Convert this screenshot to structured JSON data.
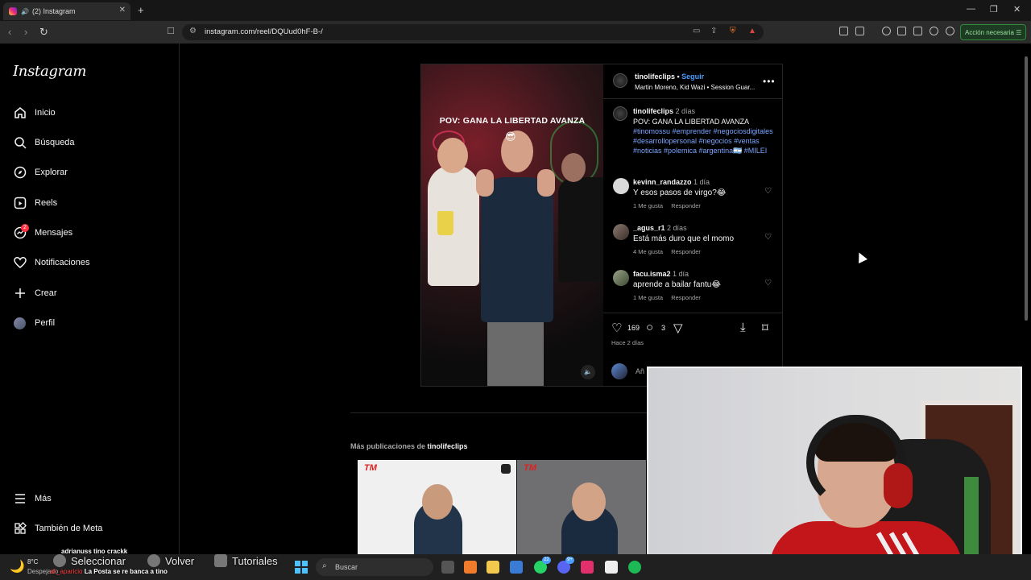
{
  "browser": {
    "tab_title": "(2) Instagram",
    "new_tab_label": "+",
    "url": "instagram.com/reel/DQUud0hF-B-/",
    "action_button": "Acción necesaria"
  },
  "sidebar": {
    "logo": "Instagram",
    "items": [
      {
        "label": "Inicio",
        "icon": "home-icon"
      },
      {
        "label": "Búsqueda",
        "icon": "search-icon"
      },
      {
        "label": "Explorar",
        "icon": "compass-icon"
      },
      {
        "label": "Reels",
        "icon": "reels-icon"
      },
      {
        "label": "Mensajes",
        "icon": "messenger-icon",
        "badge": "2"
      },
      {
        "label": "Notificaciones",
        "icon": "heart-icon"
      },
      {
        "label": "Crear",
        "icon": "plus-icon"
      },
      {
        "label": "Perfil",
        "icon": "avatar-icon"
      }
    ],
    "more": "Más",
    "meta": "También de Meta"
  },
  "post": {
    "video_caption": "POV: GANA LA LIBERTAD AVANZA",
    "video_emoji": "😎",
    "header_user": "tinolifeclips",
    "follow_separator": " • ",
    "follow_label": "Seguir",
    "header_sub": "Martin Moreno, Kid Wazi • Session Guar...",
    "caption_user": "tinolifeclips",
    "caption_time": "2 días",
    "caption_text": "POV: GANA LA LIBERTAD AVANZA",
    "hashtags": "#tinomossu #emprender #negociosdigitales #desarrollopersonal #negocios #ventas #noticias #polemica #argentina🇦🇷 #MILEI",
    "comments": [
      {
        "user": "kevinn_randazzo",
        "time": "1 día",
        "text": "Y esos pasos de virgo?😂",
        "likes": "1 Me gusta",
        "reply": "Responder"
      },
      {
        "user": "_agus_r1",
        "time": "2 días",
        "text": "Está más duro que el momo",
        "likes": "4 Me gusta",
        "reply": "Responder"
      },
      {
        "user": "facu.isma2",
        "time": "1 día",
        "text": "aprende a bailar fantu😂",
        "likes": "1 Me gusta",
        "reply": "Responder"
      }
    ],
    "likes_count": "169",
    "comments_count": "3",
    "posted_ago": "Hace 2 días",
    "add_comment_placeholder": "Añ"
  },
  "more_posts": {
    "label": "Más publicaciones de ",
    "user": "tinolifeclips",
    "thumb_logo": "TM"
  },
  "overlay": {
    "chat_line1": "adrianuss  tino crackk",
    "chat_line2_user": "ali_aparicio",
    "chat_line2_text": "La Posta se re banca a tino",
    "obs_select": "Seleccionar",
    "obs_back": "Volver",
    "obs_tutorials": "Tutoriales"
  },
  "taskbar": {
    "temp": "8°C",
    "weather": "Despejado",
    "search_placeholder": "Buscar",
    "whatsapp_badge": "22",
    "discord_badge": "9+"
  }
}
